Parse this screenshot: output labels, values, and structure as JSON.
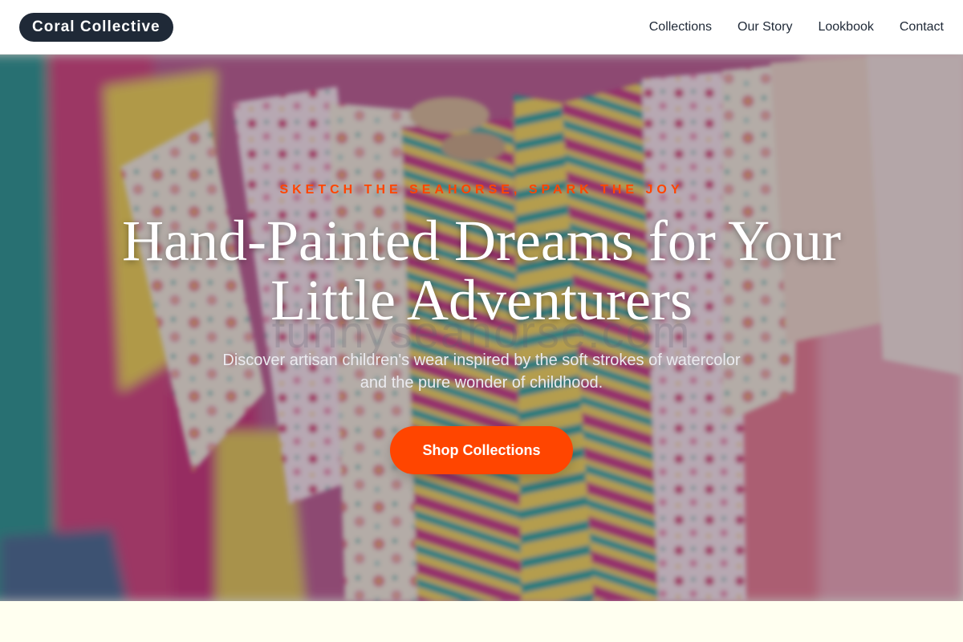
{
  "brand": {
    "name": "Coral Collective"
  },
  "nav": {
    "items": [
      {
        "label": "Collections"
      },
      {
        "label": "Our Story"
      },
      {
        "label": "Lookbook"
      },
      {
        "label": "Contact"
      }
    ]
  },
  "hero": {
    "eyebrow": "SKETCH THE SEAHORSE, SPARK THE JOY",
    "headline": "Hand-Painted Dreams for Your Little Adventurers",
    "subtext": "Discover artisan children's wear inspired by the soft strokes of watercolor and the pure wonder of childhood.",
    "cta_label": "Shop Collections",
    "watermark": "funnyseahorse.com"
  },
  "colors": {
    "accent": "#ff4500",
    "brand_dark": "#1f2937",
    "page_background": "#fffff0"
  }
}
